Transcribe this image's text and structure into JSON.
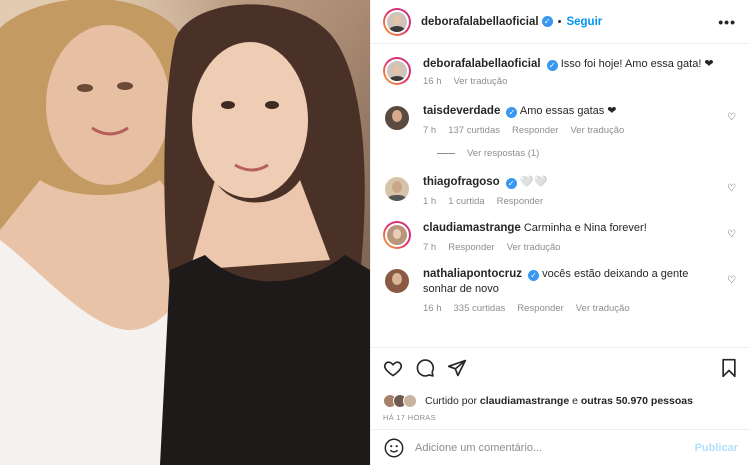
{
  "post": {
    "author": "deborafalabellaoficial",
    "follow_label": "Seguir",
    "more_label": "•••"
  },
  "caption": {
    "username": "deborafalabellaoficial",
    "text": "Isso foi hoje! Amo essa gata! ❤",
    "time": "16 h",
    "translate": "Ver tradução"
  },
  "comments": [
    {
      "username": "taisdeverdade",
      "verified": true,
      "text": "Amo essas gatas ❤",
      "time": "7 h",
      "likes": "137 curtidas",
      "reply": "Responder",
      "translate": "Ver tradução",
      "view_replies": "Ver respostas (1)"
    },
    {
      "username": "thiagofragoso",
      "verified": true,
      "text": "🤍🤍",
      "time": "1 h",
      "likes": "1 curtida",
      "reply": "Responder"
    },
    {
      "username": "claudiamastrange",
      "verified": false,
      "text": "Carminha e Nina forever!",
      "time": "7 h",
      "reply": "Responder",
      "translate": "Ver tradução"
    },
    {
      "username": "nathaliapontocruz",
      "verified": true,
      "text": "vocês estão deixando a gente sonhar de novo",
      "time": "16 h",
      "likes": "335 curtidas",
      "reply": "Responder",
      "translate": "Ver tradução"
    }
  ],
  "likes_summary": {
    "prefix": "Curtido por",
    "user": "claudiamastrange",
    "mid": "e",
    "others": "outras 50.970 pessoas"
  },
  "timestamp": "HÁ 17 HORAS",
  "composer": {
    "placeholder": "Adicione um comentário...",
    "publish": "Publicar"
  },
  "colors": {
    "accent": "#0095f6",
    "verified": "#3897f0",
    "muted": "#8e8e8e",
    "publish_disabled": "#b2dffc"
  }
}
